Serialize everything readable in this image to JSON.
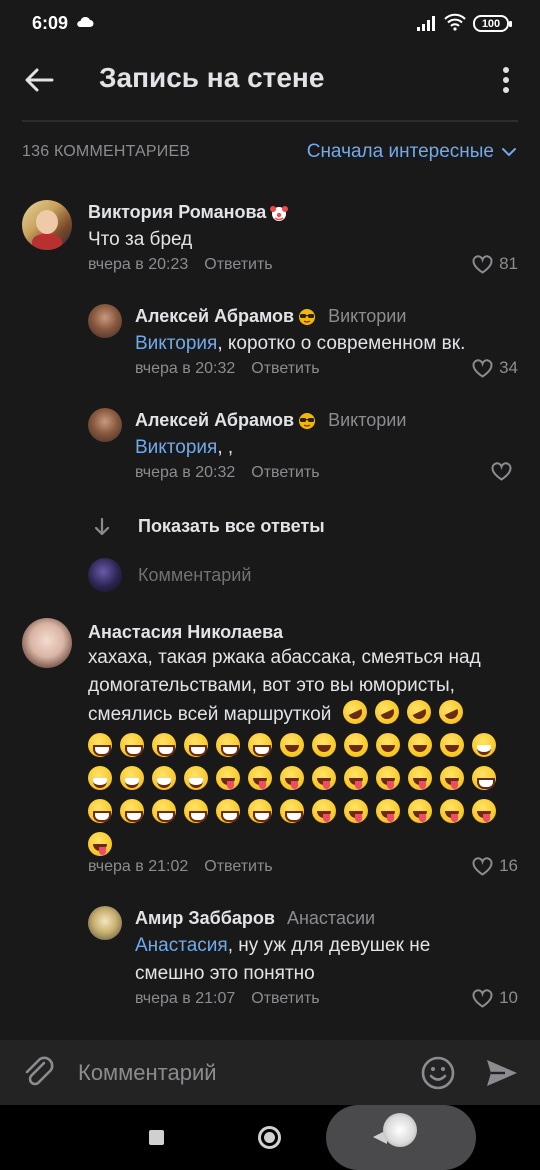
{
  "status_bar": {
    "time": "6:09",
    "battery": "100"
  },
  "header": {
    "title": "Запись на стене"
  },
  "sort_row": {
    "count_label": "136 КОММЕНТАРИЕВ",
    "sort_label": "Сначала интересные"
  },
  "comments": [
    {
      "author": "Виктория Романова",
      "text": "Что за бред",
      "time": "вчера в 20:23",
      "reply_label": "Ответить",
      "likes": "81"
    },
    {
      "author": "Алексей Абрамов",
      "reply_to": "Виктории",
      "mention": "Виктория",
      "text": ", коротко о современном вк.",
      "time": "вчера в 20:32",
      "reply_label": "Ответить",
      "likes": "34"
    },
    {
      "author": "Алексей Абрамов",
      "reply_to": "Виктории",
      "mention": "Виктория",
      "text": ", ,",
      "time": "вчера в 20:32",
      "reply_label": "Ответить",
      "likes": ""
    },
    {
      "author": "Анастасия Николаева",
      "text_line1": "хахаха, такая ржака абассака, смеяться над",
      "text_line2": "домогательствами, вот это вы юмористы,",
      "text_line3": "смеялись всей маршруткой",
      "time": "вчера в 21:02",
      "reply_label": "Ответить",
      "likes": "16"
    },
    {
      "author": "Амир Заббаров",
      "reply_to": "Анастасии",
      "mention": "Анастасия",
      "text_line1": ", ну уж для девушек не",
      "text_line2": "смешно это понятно",
      "time": "вчера в 21:07",
      "reply_label": "Ответить",
      "likes": "10"
    }
  ],
  "show_replies": {
    "label": "Показать все ответы"
  },
  "inline_comment": {
    "placeholder": "Комментарий"
  },
  "input_bar": {
    "placeholder": "Комментарий"
  },
  "colors": {
    "background": "#19191a",
    "accent": "#71aaeb",
    "secondary_text": "#8a8c90"
  },
  "icons": [
    "back-arrow-icon",
    "more-vertical-icon",
    "chevron-down-icon",
    "heart-icon",
    "arrow-down-icon",
    "paperclip-icon",
    "smiley-icon",
    "send-icon"
  ]
}
